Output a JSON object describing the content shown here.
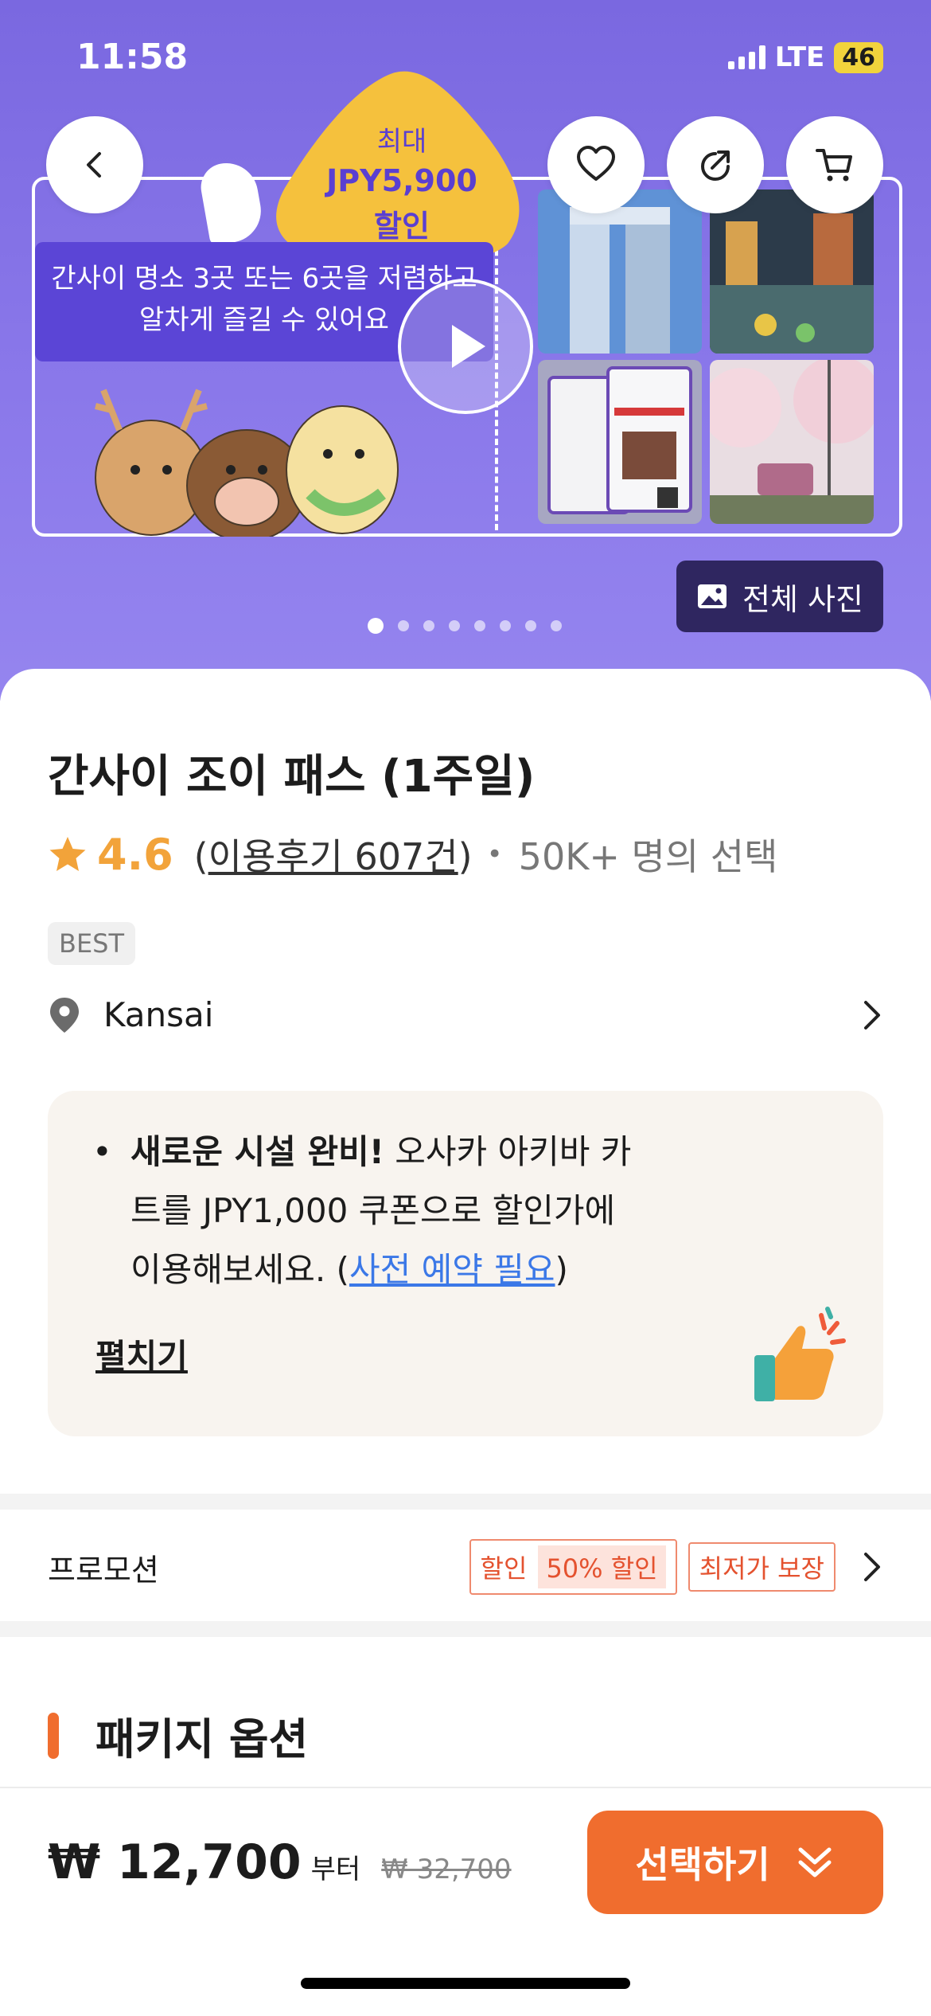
{
  "status_bar": {
    "time": "11:58",
    "network": "LTE",
    "battery": "46"
  },
  "hero": {
    "promo_line1": "최대",
    "promo_line2": "JPY5,900",
    "promo_line3": "할인",
    "description_line1": "간사이 명소 3곳 또는 6곳을 저렴하고",
    "description_line2": "알차게 즐길 수 있어요",
    "all_photos_label": "전체 사진",
    "carousel_pages": 8,
    "carousel_active": 1
  },
  "product": {
    "title": "간사이 조이 패스 (1주일)",
    "rating": "4.6",
    "reviews_open": "(",
    "reviews_label": "이용후기 607건",
    "reviews_close": ")",
    "dot": "•",
    "choice_label": "50K+ 명의 선택",
    "badge": "BEST",
    "location": "Kansai"
  },
  "notice": {
    "bullet": "•",
    "bold": "새로운 시설 완비!",
    "text_a": " 오사카 아키바 카",
    "text_b": "트를 JPY1,000 쿠폰으로 할인가에",
    "text_c": "이용해보세요. (",
    "link": "사전 예약 필요",
    "text_d": ")",
    "expand_label": "펼치기"
  },
  "promotion": {
    "label": "프로모션",
    "tag_discount": "할인",
    "tag_percent": "50% 할인",
    "tag_lowest": "최저가 보장"
  },
  "package": {
    "title": "패키지 옵션"
  },
  "footer": {
    "price": "₩ 12,700",
    "from": "부터",
    "old_price": "₩ 32,700",
    "select_label": "선택하기"
  },
  "colors": {
    "accent": "#f06d2e",
    "hero": "#8a78ea",
    "star": "#f2a33a",
    "link": "#3b78e7"
  }
}
